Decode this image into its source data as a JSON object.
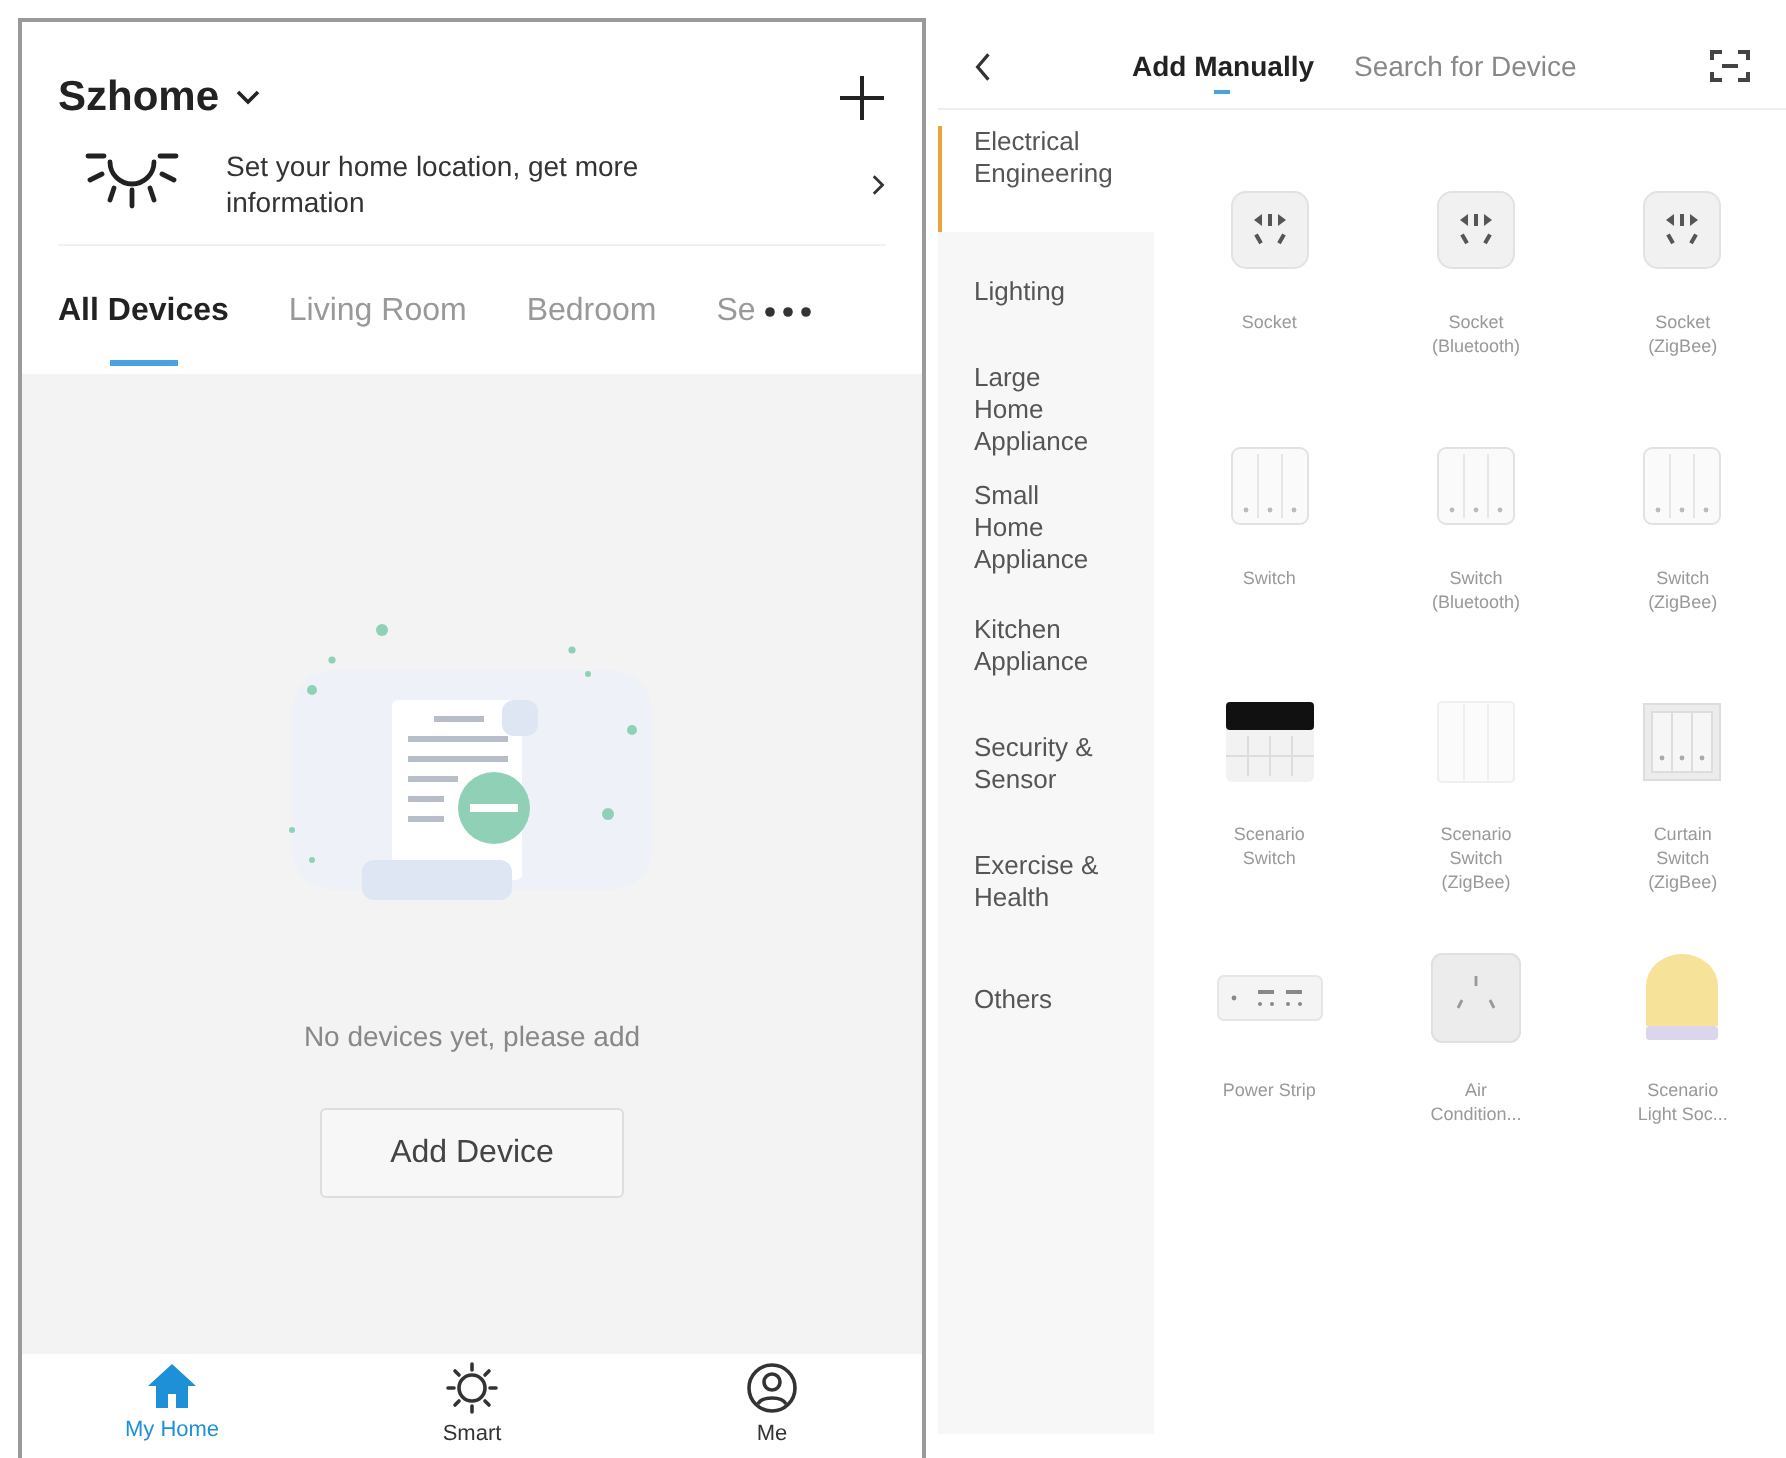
{
  "home": {
    "title": "Szhome",
    "location_prompt": "Set your home location, get more information",
    "room_tabs": [
      {
        "label": "All Devices",
        "selected": true
      },
      {
        "label": "Living Room",
        "selected": false
      },
      {
        "label": "Bedroom",
        "selected": false
      },
      {
        "label": "Se",
        "selected": false
      }
    ],
    "empty_message": "No devices yet, please add",
    "add_button": "Add Device",
    "nav": [
      {
        "label": "My Home",
        "kind": "home",
        "selected": true
      },
      {
        "label": "Smart",
        "kind": "smart",
        "selected": false
      },
      {
        "label": "Me",
        "kind": "me",
        "selected": false
      }
    ]
  },
  "add_device": {
    "tabs": [
      {
        "label": "Add Manually",
        "selected": true
      },
      {
        "label": "Search for Device",
        "selected": false
      }
    ],
    "categories": [
      {
        "label": "Electrical Engineering",
        "selected": true
      },
      {
        "label": "Lighting",
        "selected": false
      },
      {
        "label": "Large Home Appliance",
        "selected": false
      },
      {
        "label": "Small Home Appliance",
        "selected": false
      },
      {
        "label": "Kitchen Appliance",
        "selected": false
      },
      {
        "label": "Security & Sensor",
        "selected": false
      },
      {
        "label": "Exercise & Health",
        "selected": false
      },
      {
        "label": "Others",
        "selected": false
      }
    ],
    "devices": [
      {
        "kind": "socket",
        "lines": [
          "Socket"
        ]
      },
      {
        "kind": "socket",
        "lines": [
          "Socket",
          "(Bluetooth)"
        ]
      },
      {
        "kind": "socket",
        "lines": [
          "Socket",
          "(ZigBee)"
        ]
      },
      {
        "kind": "switch",
        "lines": [
          "Switch"
        ]
      },
      {
        "kind": "switch",
        "lines": [
          "Switch",
          "(Bluetooth)"
        ]
      },
      {
        "kind": "switch",
        "lines": [
          "Switch",
          "(ZigBee)"
        ]
      },
      {
        "kind": "scene-panel",
        "lines": [
          "Scenario",
          "Switch"
        ]
      },
      {
        "kind": "plain-panel",
        "lines": [
          "Scenario",
          "Switch",
          "(ZigBee)"
        ]
      },
      {
        "kind": "curtain",
        "lines": [
          "Curtain",
          "Switch",
          "(ZigBee)"
        ]
      },
      {
        "kind": "strip",
        "lines": [
          "Power Strip"
        ]
      },
      {
        "kind": "ac",
        "lines": [
          "Air",
          "Condition..."
        ]
      },
      {
        "kind": "lamp",
        "lines": [
          "Scenario",
          "Light Soc..."
        ]
      }
    ]
  }
}
